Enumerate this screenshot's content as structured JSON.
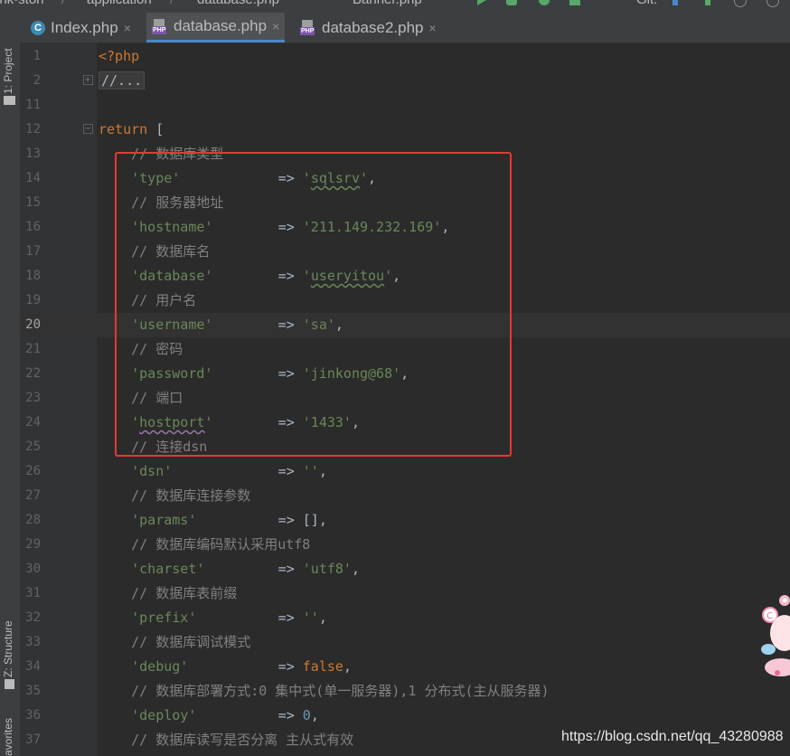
{
  "topbar": {
    "crumbs": [
      "ink-ston",
      "/",
      "application",
      "/",
      "database.php",
      "Banner.php",
      "Git:"
    ]
  },
  "tabs": [
    {
      "label": "Index.php",
      "icon": "c-class-icon",
      "active": false,
      "close": "×"
    },
    {
      "label": "database.php",
      "icon": "php-file-icon",
      "active": true,
      "close": "×"
    },
    {
      "label": "database2.php",
      "icon": "php-file-icon",
      "active": false,
      "close": "×"
    }
  ],
  "sidebar": {
    "project": "1: Project",
    "structure": "Z: Structure",
    "favorites": "avorites"
  },
  "lines": [
    {
      "n": "1",
      "tokens": [
        [
          "kw",
          "<?php"
        ]
      ]
    },
    {
      "n": "2",
      "tokens": [
        [
          "folded",
          "//..."
        ]
      ],
      "fold": "+"
    },
    {
      "n": "11",
      "tokens": []
    },
    {
      "n": "12",
      "tokens": [
        [
          "kw",
          "return"
        ],
        [
          "op",
          " ["
        ]
      ],
      "fold": "-"
    },
    {
      "n": "13",
      "tokens": [
        [
          "cm",
          "    // 数据库类型"
        ]
      ]
    },
    {
      "n": "14",
      "tokens": [
        [
          "str",
          "    'type'"
        ],
        [
          "op",
          "            => "
        ],
        [
          "str",
          "'"
        ],
        [
          "ul",
          "sqlsrv"
        ],
        [
          "str",
          "'"
        ],
        [
          "op",
          ","
        ]
      ]
    },
    {
      "n": "15",
      "tokens": [
        [
          "cm",
          "    // 服务器地址"
        ]
      ]
    },
    {
      "n": "16",
      "tokens": [
        [
          "str",
          "    'hostname'"
        ],
        [
          "op",
          "        => "
        ],
        [
          "str",
          "'211.149.232.169'"
        ],
        [
          "op",
          ","
        ]
      ]
    },
    {
      "n": "17",
      "tokens": [
        [
          "cm",
          "    // 数据库名"
        ]
      ]
    },
    {
      "n": "18",
      "tokens": [
        [
          "str",
          "    'database'"
        ],
        [
          "op",
          "        => "
        ],
        [
          "str",
          "'"
        ],
        [
          "ul",
          "useryitou"
        ],
        [
          "str",
          "'"
        ],
        [
          "op",
          ","
        ]
      ]
    },
    {
      "n": "19",
      "tokens": [
        [
          "cm",
          "    // 用户名"
        ]
      ]
    },
    {
      "n": "20",
      "tokens": [
        [
          "str",
          "    'username'"
        ],
        [
          "op",
          "        => "
        ],
        [
          "str",
          "'sa'"
        ],
        [
          "op",
          ","
        ]
      ],
      "current": true
    },
    {
      "n": "21",
      "tokens": [
        [
          "cm",
          "    // 密码"
        ]
      ]
    },
    {
      "n": "22",
      "tokens": [
        [
          "str",
          "    'password'"
        ],
        [
          "op",
          "        => "
        ],
        [
          "str",
          "'jinkong@68'"
        ],
        [
          "op",
          ","
        ]
      ]
    },
    {
      "n": "23",
      "tokens": [
        [
          "cm",
          "    // 端口"
        ]
      ]
    },
    {
      "n": "24",
      "tokens": [
        [
          "str",
          "    '"
        ],
        [
          "ul2",
          "hostport"
        ],
        [
          "str",
          "'"
        ],
        [
          "op",
          "        => "
        ],
        [
          "str",
          "'1433'"
        ],
        [
          "op",
          ","
        ]
      ]
    },
    {
      "n": "25",
      "tokens": [
        [
          "cm",
          "    // 连接dsn"
        ]
      ]
    },
    {
      "n": "26",
      "tokens": [
        [
          "str",
          "    'dsn'"
        ],
        [
          "op",
          "             => "
        ],
        [
          "str",
          "''"
        ],
        [
          "op",
          ","
        ]
      ]
    },
    {
      "n": "27",
      "tokens": [
        [
          "cm",
          "    // 数据库连接参数"
        ]
      ]
    },
    {
      "n": "28",
      "tokens": [
        [
          "str",
          "    'params'"
        ],
        [
          "op",
          "          => [],"
        ]
      ]
    },
    {
      "n": "29",
      "tokens": [
        [
          "cm",
          "    // 数据库编码默认采用utf8"
        ]
      ]
    },
    {
      "n": "30",
      "tokens": [
        [
          "str",
          "    'charset'"
        ],
        [
          "op",
          "         => "
        ],
        [
          "str",
          "'utf8'"
        ],
        [
          "op",
          ","
        ]
      ]
    },
    {
      "n": "31",
      "tokens": [
        [
          "cm",
          "    // 数据库表前缀"
        ]
      ]
    },
    {
      "n": "32",
      "tokens": [
        [
          "str",
          "    'prefix'"
        ],
        [
          "op",
          "          => "
        ],
        [
          "str",
          "''"
        ],
        [
          "op",
          ","
        ]
      ]
    },
    {
      "n": "33",
      "tokens": [
        [
          "cm",
          "    // 数据库调试模式"
        ]
      ]
    },
    {
      "n": "34",
      "tokens": [
        [
          "str",
          "    'debug'"
        ],
        [
          "op",
          "           => "
        ],
        [
          "kw",
          "false"
        ],
        [
          "op",
          ","
        ]
      ]
    },
    {
      "n": "35",
      "tokens": [
        [
          "cm",
          "    // 数据库部署方式:0 集中式(单一服务器),1 分布式(主从服务器)"
        ]
      ]
    },
    {
      "n": "36",
      "tokens": [
        [
          "str",
          "    'deploy'"
        ],
        [
          "op",
          "          => "
        ],
        [
          "num",
          "0"
        ],
        [
          "op",
          ","
        ]
      ]
    },
    {
      "n": "37",
      "tokens": [
        [
          "cm",
          "    // 数据库读写是否分离 主从式有效"
        ]
      ]
    }
  ],
  "watermark": "https://blog.csdn.net/qq_43280988",
  "colors": {
    "accent_box": "#e53935",
    "tab_underline": "#4a88c7"
  }
}
